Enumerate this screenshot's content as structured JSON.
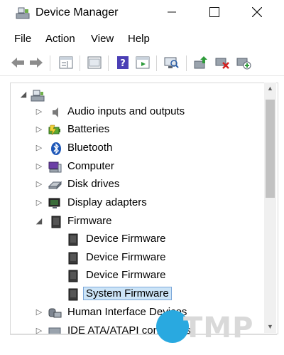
{
  "window": {
    "title": "Device Manager",
    "controls": {
      "minimize": "—",
      "maximize": "☐",
      "close": "✕"
    }
  },
  "menu": {
    "items": [
      "File",
      "Action",
      "View",
      "Help"
    ]
  },
  "toolbar": {
    "buttons": [
      {
        "icon": "back-arrow-icon"
      },
      {
        "icon": "forward-arrow-icon"
      },
      {
        "icon": "properties-icon"
      },
      {
        "icon": "console-tree-icon"
      },
      {
        "icon": "help-icon"
      },
      {
        "icon": "run-icon"
      },
      {
        "icon": "scan-hardware-icon"
      },
      {
        "icon": "update-driver-icon"
      },
      {
        "icon": "uninstall-device-icon"
      },
      {
        "icon": "add-legacy-hardware-icon"
      }
    ]
  },
  "tree": {
    "root": {
      "label": "",
      "expander": "◢",
      "icon": "computer-root-icon"
    },
    "nodes": [
      {
        "label": "Audio inputs and outputs",
        "expander": "▷",
        "icon": "speaker-icon"
      },
      {
        "label": "Batteries",
        "expander": "▷",
        "icon": "battery-icon"
      },
      {
        "label": "Bluetooth",
        "expander": "▷",
        "icon": "bluetooth-icon"
      },
      {
        "label": "Computer",
        "expander": "▷",
        "icon": "computer-icon"
      },
      {
        "label": "Disk drives",
        "expander": "▷",
        "icon": "disk-drive-icon"
      },
      {
        "label": "Display adapters",
        "expander": "▷",
        "icon": "display-adapter-icon"
      },
      {
        "label": "Firmware",
        "expander": "◢",
        "icon": "firmware-icon"
      },
      {
        "label": "Device Firmware",
        "expander": "",
        "icon": "firmware-chip-icon",
        "child": true
      },
      {
        "label": "Device Firmware",
        "expander": "",
        "icon": "firmware-chip-icon",
        "child": true
      },
      {
        "label": "Device Firmware",
        "expander": "",
        "icon": "firmware-chip-icon",
        "child": true
      },
      {
        "label": "System Firmware",
        "expander": "",
        "icon": "firmware-chip-icon",
        "child": true,
        "selected": true
      },
      {
        "label": "Human Interface Devices",
        "expander": "▷",
        "icon": "hid-icon"
      },
      {
        "label": "IDE ATA/ATAPI controllers",
        "expander": "▷",
        "icon": "ide-controller-icon"
      }
    ]
  },
  "scrollbar": {
    "up": "▲",
    "down": "▼"
  },
  "watermark": {
    "text": "TMP"
  },
  "colors": {
    "selection_bg": "#cce4f7",
    "selection_border": "#7aa7d9",
    "accent": "#29a9e0"
  }
}
